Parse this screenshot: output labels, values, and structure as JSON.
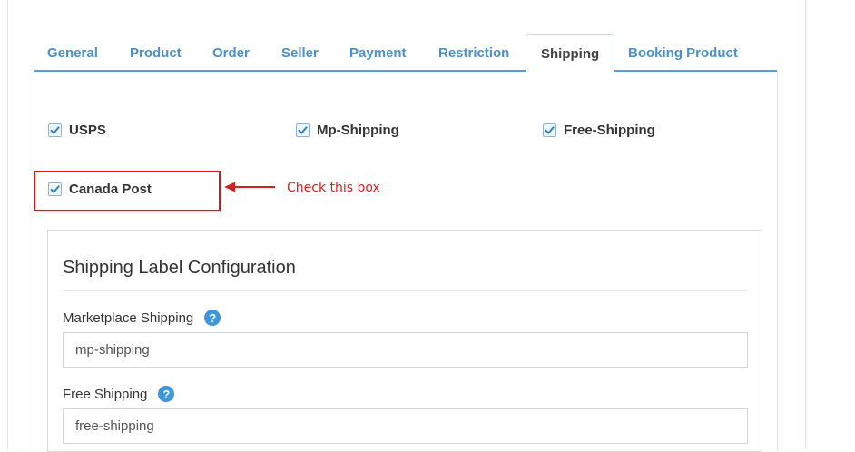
{
  "tabs": [
    {
      "label": "General"
    },
    {
      "label": "Product"
    },
    {
      "label": "Order"
    },
    {
      "label": "Seller"
    },
    {
      "label": "Payment"
    },
    {
      "label": "Restriction"
    },
    {
      "label": "Shipping",
      "active": true
    },
    {
      "label": "Booking Product"
    }
  ],
  "shipping_methods": [
    {
      "label": "USPS",
      "checked": true
    },
    {
      "label": "Mp-Shipping",
      "checked": true
    },
    {
      "label": "Free-Shipping",
      "checked": true
    },
    {
      "label": "Canada Post",
      "checked": true
    }
  ],
  "annotation": {
    "text": "Check this box"
  },
  "label_config": {
    "title": "Shipping Label Configuration",
    "fields": [
      {
        "label": "Marketplace Shipping",
        "value": "mp-shipping"
      },
      {
        "label": "Free Shipping",
        "value": "free-shipping"
      }
    ]
  },
  "colors": {
    "accent": "#4a90c9",
    "tab_underline": "#5b9bd5",
    "highlight": "#e01212",
    "help_icon": "#3e97dc"
  }
}
